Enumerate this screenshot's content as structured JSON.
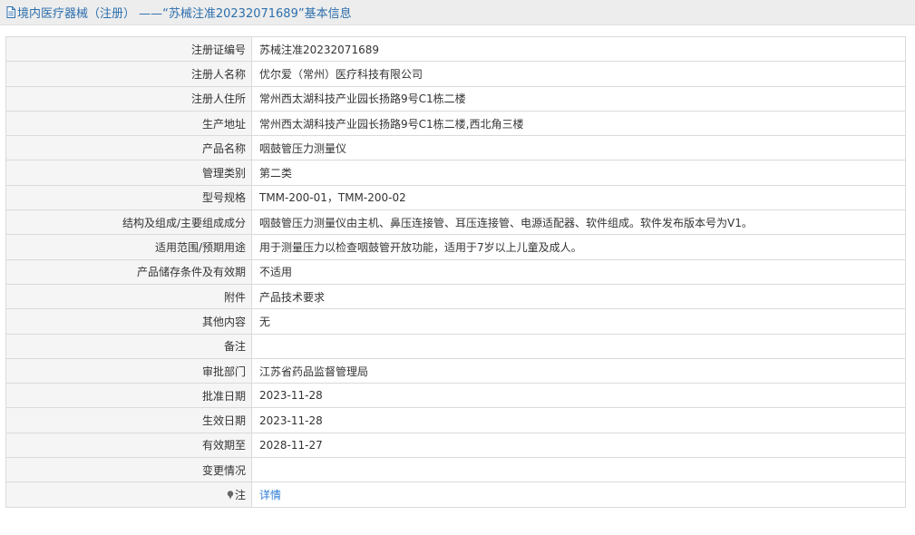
{
  "header": {
    "title": "境内医疗器械（注册） ——“苏械注准20232071689”基本信息"
  },
  "rows": [
    {
      "label": "注册证编号",
      "value": "苏械注准20232071689"
    },
    {
      "label": "注册人名称",
      "value": "优尔爱（常州）医疗科技有限公司"
    },
    {
      "label": "注册人住所",
      "value": "常州西太湖科技产业园长扬路9号C1栋二楼"
    },
    {
      "label": "生产地址",
      "value": "常州西太湖科技产业园长扬路9号C1栋二楼,西北角三楼"
    },
    {
      "label": "产品名称",
      "value": "咽鼓管压力测量仪"
    },
    {
      "label": "管理类别",
      "value": "第二类"
    },
    {
      "label": "型号规格",
      "value": "TMM-200-01，TMM-200-02"
    },
    {
      "label": "结构及组成/主要组成成分",
      "value": "咽鼓管压力测量仪由主机、鼻压连接管、耳压连接管、电源适配器、软件组成。软件发布版本号为V1。"
    },
    {
      "label": "适用范围/预期用途",
      "value": "用于测量压力以检查咽鼓管开放功能，适用于7岁以上儿童及成人。"
    },
    {
      "label": "产品储存条件及有效期",
      "value": "不适用"
    },
    {
      "label": "附件",
      "value": "产品技术要求"
    },
    {
      "label": "其他内容",
      "value": "无"
    },
    {
      "label": "备注",
      "value": ""
    },
    {
      "label": "审批部门",
      "value": "江苏省药品监督管理局"
    },
    {
      "label": "批准日期",
      "value": "2023-11-28"
    },
    {
      "label": "生效日期",
      "value": "2023-11-28"
    },
    {
      "label": "有效期至",
      "value": "2028-11-27"
    },
    {
      "label": "变更情况",
      "value": ""
    }
  ],
  "note": {
    "icon": "pin-icon",
    "label": "注",
    "link_text": "详情"
  },
  "colors": {
    "header_bg": "#ededed",
    "title": "#2c6fad",
    "label_bg": "#f5f5f5",
    "border": "#dadada",
    "link": "#2c7bd6"
  }
}
